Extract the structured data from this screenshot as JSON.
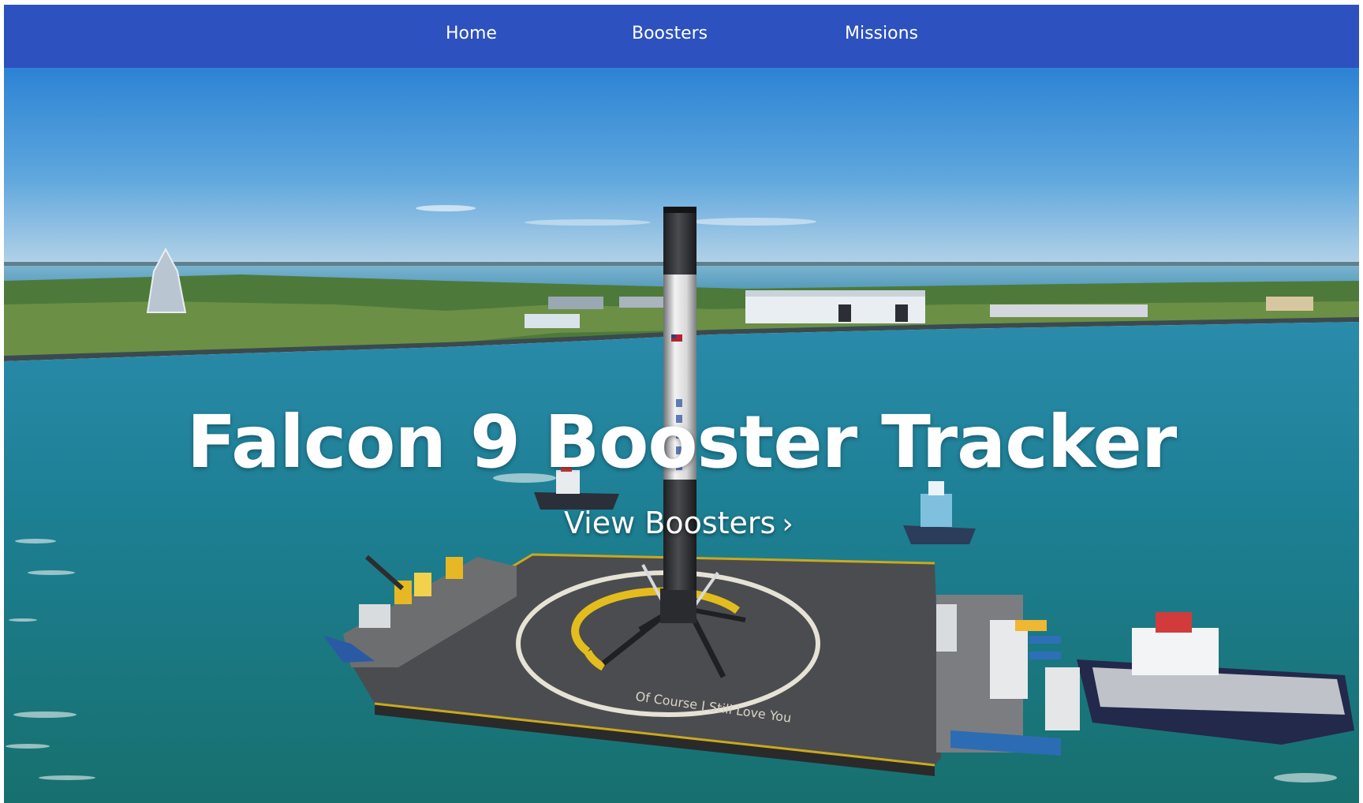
{
  "nav": {
    "items": [
      {
        "label": "Home"
      },
      {
        "label": "Boosters"
      },
      {
        "label": "Missions"
      }
    ]
  },
  "hero": {
    "title": "Falcon 9 Booster Tracker",
    "cta_label": "View Boosters",
    "cta_icon": "chevron-right-icon",
    "background_image": "falcon-9-booster-on-droneship-in-port",
    "droneship_text": "Of Course I Still Love You"
  },
  "colors": {
    "nav_background": "#2d51be",
    "nav_text": "#ffffff",
    "sky_top": "#2f86d6",
    "sky_horizon": "#a9cce6",
    "water": "#1f7f90",
    "title_text": "#ffffff"
  }
}
